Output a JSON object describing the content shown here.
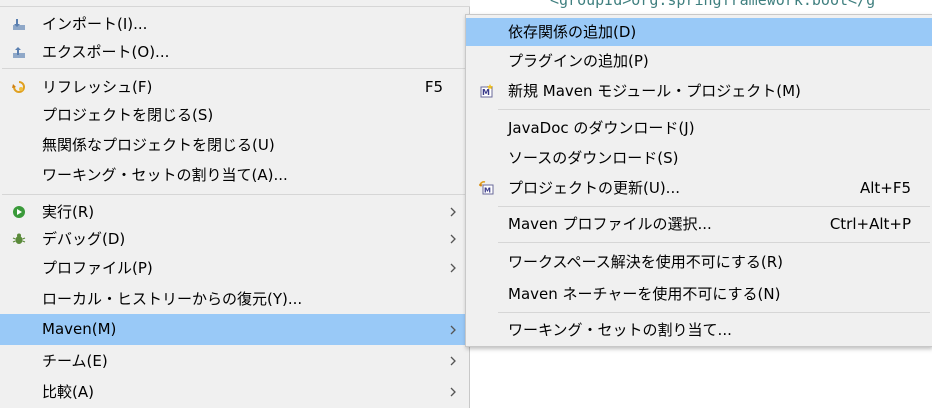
{
  "main_menu": {
    "items": [
      {
        "label": "インポート(I)...",
        "icon": "import-icon"
      },
      {
        "label": "エクスポート(O)...",
        "icon": "export-icon"
      },
      {
        "label": "リフレッシュ(F)",
        "icon": "refresh-icon",
        "shortcut": "F5"
      },
      {
        "label": "プロジェクトを閉じる(S)"
      },
      {
        "label": "無関係なプロジェクトを閉じる(U)"
      },
      {
        "label": "ワーキング・セットの割り当て(A)..."
      },
      {
        "label": "実行(R)",
        "icon": "run-icon",
        "submenu": true
      },
      {
        "label": "デバッグ(D)",
        "icon": "debug-bug-icon",
        "submenu": true
      },
      {
        "label": "プロファイル(P)",
        "submenu": true
      },
      {
        "label": "ローカル・ヒストリーからの復元(Y)..."
      },
      {
        "label": "Maven(M)",
        "submenu": true,
        "selected": true
      },
      {
        "label": "チーム(E)",
        "submenu": true
      },
      {
        "label": "比較(A)",
        "submenu": true
      }
    ]
  },
  "maven_submenu": {
    "items": [
      {
        "label": "依存関係の追加(D)",
        "selected": true
      },
      {
        "label": "プラグインの追加(P)"
      },
      {
        "label": "新規 Maven モジュール・プロジェクト(M)",
        "icon": "maven-new-module-icon"
      },
      {
        "label": "JavaDoc のダウンロード(J)"
      },
      {
        "label": "ソースのダウンロード(S)"
      },
      {
        "label": "プロジェクトの更新(U)...",
        "icon": "maven-update-icon",
        "shortcut": "Alt+F5"
      },
      {
        "label": "Maven プロファイルの選択...",
        "shortcut": "Ctrl+Alt+P"
      },
      {
        "label": "ワークスペース解決を使用不可にする(R)"
      },
      {
        "label": "Maven ネーチャーを使用不可にする(N)"
      },
      {
        "label": "ワーキング・セットの割り当て..."
      }
    ]
  },
  "editor_snippet": "<groupId>org.springframework.boot</g",
  "colors": {
    "menu_bg": "#f0f0f0",
    "selection": "#99c9f7",
    "separator": "#d6d6d6"
  }
}
